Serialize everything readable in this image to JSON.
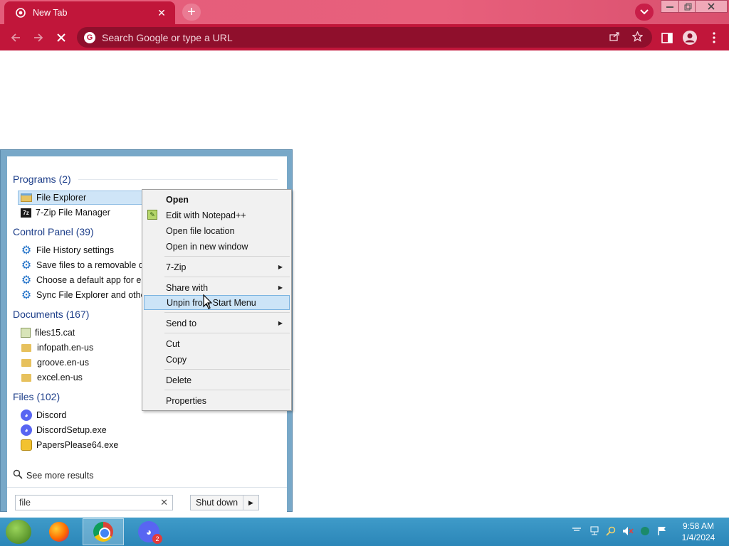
{
  "browser": {
    "tab_title": "New Tab",
    "tab_favicon": "chrome-favicon",
    "omnibox_placeholder": "Search Google or type a URL",
    "accent_color": "#c1163a"
  },
  "startmenu": {
    "sections": {
      "programs": "Programs (2)",
      "control_panel": "Control Panel (39)",
      "documents": "Documents (167)",
      "files": "Files (102)"
    },
    "programs": [
      "File Explorer",
      "7-Zip File Manager"
    ],
    "control_panel": [
      "File History settings",
      "Save files to a removable driv",
      "Choose a default app for eac",
      "Sync File Explorer and other"
    ],
    "documents": [
      "files15.cat",
      "infopath.en-us",
      "groove.en-us",
      "excel.en-us"
    ],
    "files": [
      "Discord",
      "DiscordSetup.exe",
      "PapersPlease64.exe"
    ],
    "see_more": "See more results",
    "search_value": "file",
    "shutdown_label": "Shut down"
  },
  "context_menu": {
    "items": [
      "Open",
      "Edit with Notepad++",
      "Open file location",
      "Open in new window",
      "7-Zip",
      "Share with",
      "Unpin from Start Menu",
      "Send to",
      "Cut",
      "Copy",
      "Delete",
      "Properties"
    ],
    "highlighted": "Unpin from Start Menu"
  },
  "taskbar": {
    "discord_badge": "2",
    "time": "9:58 AM",
    "date": "1/4/2024"
  }
}
